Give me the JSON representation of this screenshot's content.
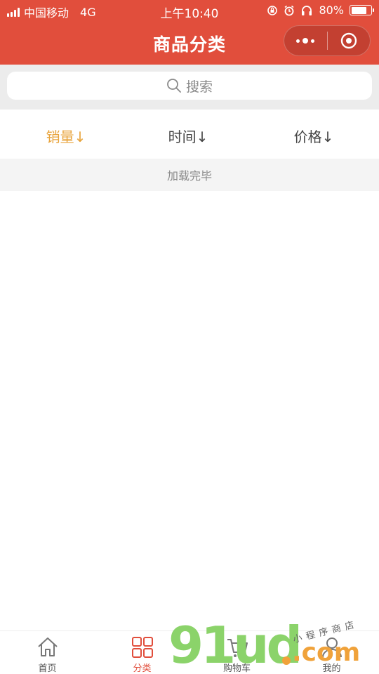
{
  "status_bar": {
    "carrier": "中国移动",
    "network": "4G",
    "time": "上午10:40",
    "battery": "80%",
    "battery_level": 0.8,
    "icons": [
      "signal-icon",
      "rotation-lock-icon",
      "alarm-icon",
      "headphones-icon",
      "battery-icon"
    ]
  },
  "nav": {
    "title": "商品分类",
    "more_icon": "more-dots-icon",
    "close_icon": "target-circle-icon"
  },
  "search": {
    "placeholder": "搜索",
    "icon": "search-icon"
  },
  "sort": {
    "items": [
      {
        "label": "销量↓",
        "active": true
      },
      {
        "label": "时间↓",
        "active": false
      },
      {
        "label": "价格↓",
        "active": false
      }
    ]
  },
  "list": {
    "status_text": "加载完毕"
  },
  "tab_bar": {
    "items": [
      {
        "label": "首页",
        "icon": "home-icon",
        "active": false
      },
      {
        "label": "分类",
        "icon": "grid-icon",
        "active": true
      },
      {
        "label": "购物车",
        "icon": "cart-icon",
        "active": false
      },
      {
        "label": "我的",
        "icon": "user-icon",
        "active": false
      }
    ]
  },
  "watermark": {
    "brand": "91ud",
    "domain": ".com",
    "tagline": "小程序商店"
  },
  "colors": {
    "brand": "#e14e3c",
    "active_sort": "#e8a33a",
    "watermark_green": "#8bd36a",
    "watermark_orange": "#f0a23a"
  }
}
